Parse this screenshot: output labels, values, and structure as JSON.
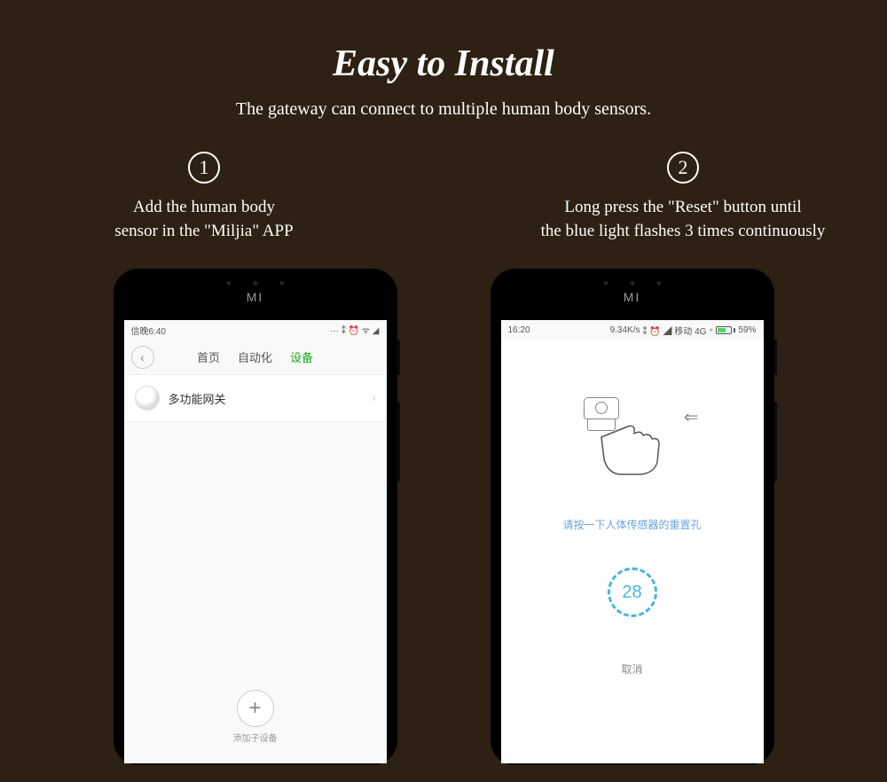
{
  "header": {
    "title": "Easy to Install",
    "subtitle": "The gateway can connect to multiple human body sensors."
  },
  "steps": [
    {
      "number": "1",
      "caption_line1": "Add the human body",
      "caption_line2": "sensor in the \"Miljia\" APP"
    },
    {
      "number": "2",
      "caption_line1": "Long press the \"Reset\" button until",
      "caption_line2": "the blue light flashes 3 times continuously"
    }
  ],
  "phone_brand": "MI",
  "screen1": {
    "status": {
      "time": "信晚6:40",
      "icons": "··· ⁑ ⏰ ᯤ ◢"
    },
    "tabs": [
      "首页",
      "自动化",
      "设备"
    ],
    "active_tab": 2,
    "item_label": "多功能网关",
    "add_label": "添加子设备"
  },
  "screen2": {
    "status": {
      "time": "16:20",
      "rate": "9.34K/s",
      "icons": "⁑ ⏰ ◢ 移动 4G ⁺",
      "battery_pct": "59%",
      "battery_fill": 59
    },
    "instruction": "请按一下人体传感器的重置孔",
    "countdown": "28",
    "cancel": "取消"
  }
}
